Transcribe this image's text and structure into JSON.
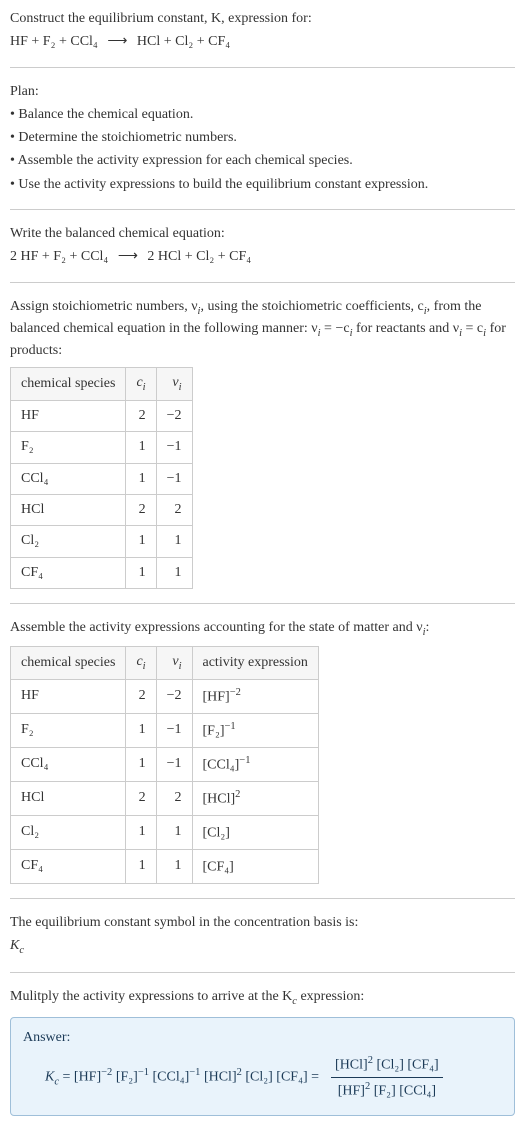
{
  "prompt": {
    "line1": "Construct the equilibrium constant, K, expression for:"
  },
  "plan": {
    "heading": "Plan:",
    "b1": "• Balance the chemical equation.",
    "b2": "• Determine the stoichiometric numbers.",
    "b3": "• Assemble the activity expression for each chemical species.",
    "b4": "• Use the activity expressions to build the equilibrium constant expression."
  },
  "balanced": {
    "heading": "Write the balanced chemical equation:"
  },
  "stoich": {
    "intro1": "Assign stoichiometric numbers, ν",
    "intro1sub": "i",
    "intro2": ", using the stoichiometric coefficients, c",
    "intro2sub": "i",
    "intro3": ", from the balanced chemical equation in the following manner: ν",
    "intro3sub": "i",
    "intro4": " = −c",
    "intro4sub": "i",
    "intro5": " for reactants and ν",
    "intro5sub": "i",
    "intro6": " = c",
    "intro6sub": "i",
    "intro7": " for products:"
  },
  "table1": {
    "h1": "chemical species",
    "h2": "c",
    "h2sub": "i",
    "h3": "ν",
    "h3sub": "i",
    "rows": [
      {
        "sp": "HF",
        "c": "2",
        "v": "−2"
      },
      {
        "sp": "F₂",
        "c": "1",
        "v": "−1"
      },
      {
        "sp": "CCl₄",
        "c": "1",
        "v": "−1"
      },
      {
        "sp": "HCl",
        "c": "2",
        "v": "2"
      },
      {
        "sp": "Cl₂",
        "c": "1",
        "v": "1"
      },
      {
        "sp": "CF₄",
        "c": "1",
        "v": "1"
      }
    ]
  },
  "assemble": {
    "heading1": "Assemble the activity expressions accounting for the state of matter and ν",
    "headingsub": "i",
    "heading2": ":"
  },
  "table2": {
    "h1": "chemical species",
    "h2": "c",
    "h2sub": "i",
    "h3": "ν",
    "h3sub": "i",
    "h4": "activity expression",
    "rows": [
      {
        "sp": "HF",
        "c": "2",
        "v": "−2",
        "a_base": "[HF]",
        "a_exp": "−2"
      },
      {
        "sp": "F₂",
        "c": "1",
        "v": "−1",
        "a_base": "[F₂]",
        "a_exp": "−1"
      },
      {
        "sp": "CCl₄",
        "c": "1",
        "v": "−1",
        "a_base": "[CCl₄]",
        "a_exp": "−1"
      },
      {
        "sp": "HCl",
        "c": "2",
        "v": "2",
        "a_base": "[HCl]",
        "a_exp": "2"
      },
      {
        "sp": "Cl₂",
        "c": "1",
        "v": "1",
        "a_base": "[Cl₂]",
        "a_exp": ""
      },
      {
        "sp": "CF₄",
        "c": "1",
        "v": "1",
        "a_base": "[CF₄]",
        "a_exp": ""
      }
    ]
  },
  "kc_symbol": {
    "heading": "The equilibrium constant symbol in the concentration basis is:",
    "sym": "K",
    "sub": "c"
  },
  "multiply": {
    "heading1": "Mulitply the activity expressions to arrive at the K",
    "headingsub": "c",
    "heading2": " expression:"
  },
  "answer": {
    "label": "Answer:",
    "left1": "K",
    "leftsub": "c",
    "left2": " = [HF]",
    "e1": "−2",
    "p2": " [F₂]",
    "e2": "−1",
    "p3": " [CCl₄]",
    "e3": "−1",
    "p4": " [HCl]",
    "e4": "2",
    "p5": " [Cl₂] [CF₄] = ",
    "num1": "[HCl]",
    "nume1": "2",
    "num2": " [Cl₂] [CF₄]",
    "den1": "[HF]",
    "dene1": "2",
    "den2": " [F₂] [CCl₄]"
  },
  "chem": {
    "unbalanced_lhs": "HF + F₂ + CCl₄",
    "arrow": "⟶",
    "unbalanced_rhs": "HCl + Cl₂ + CF₄",
    "balanced_lhs": "2 HF + F₂ + CCl₄",
    "balanced_rhs": "2 HCl + Cl₂ + CF₄"
  },
  "chart_data": {
    "type": "table",
    "tables": [
      {
        "columns": [
          "chemical species",
          "c_i",
          "ν_i"
        ],
        "rows": [
          [
            "HF",
            2,
            -2
          ],
          [
            "F2",
            1,
            -1
          ],
          [
            "CCl4",
            1,
            -1
          ],
          [
            "HCl",
            2,
            2
          ],
          [
            "Cl2",
            1,
            1
          ],
          [
            "CF4",
            1,
            1
          ]
        ]
      },
      {
        "columns": [
          "chemical species",
          "c_i",
          "ν_i",
          "activity expression"
        ],
        "rows": [
          [
            "HF",
            2,
            -2,
            "[HF]^-2"
          ],
          [
            "F2",
            1,
            -1,
            "[F2]^-1"
          ],
          [
            "CCl4",
            1,
            -1,
            "[CCl4]^-1"
          ],
          [
            "HCl",
            2,
            2,
            "[HCl]^2"
          ],
          [
            "Cl2",
            1,
            1,
            "[Cl2]"
          ],
          [
            "CF4",
            1,
            1,
            "[CF4]"
          ]
        ]
      }
    ]
  }
}
